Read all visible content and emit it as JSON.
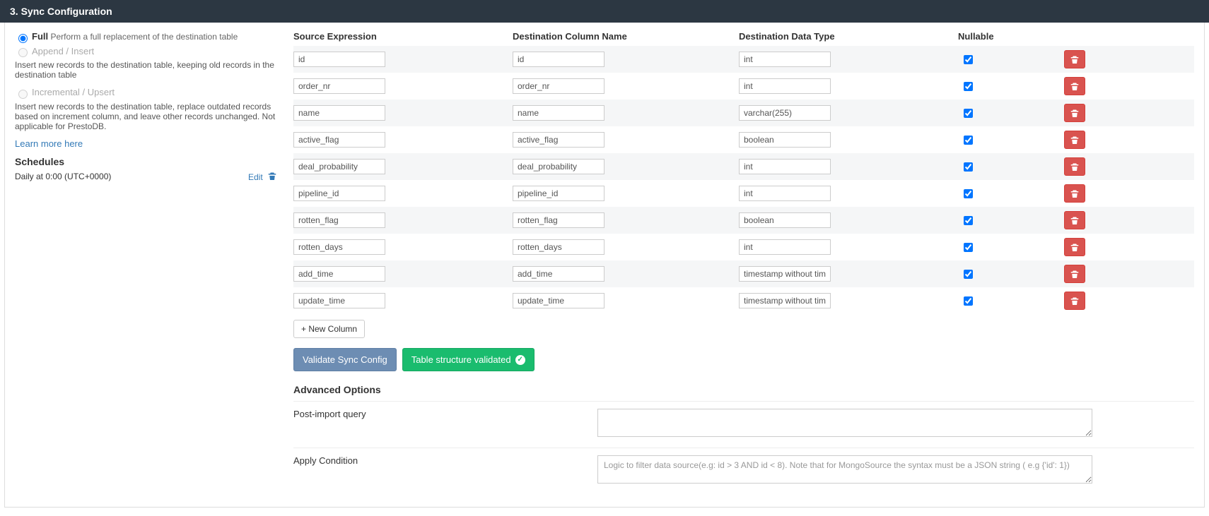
{
  "header": {
    "title": "3. Sync Configuration"
  },
  "sidebar": {
    "modes": [
      {
        "label": "Full",
        "desc": "Perform a full replacement of the destination table",
        "checked": true,
        "disabled": false,
        "inline": true
      },
      {
        "label": "Append / Insert",
        "desc": "Insert new records to the destination table, keeping old records in the destination table",
        "checked": false,
        "disabled": true,
        "inline": false
      },
      {
        "label": "Incremental / Upsert",
        "desc": "Insert new records to the destination table, replace outdated records based on increment column, and leave other records unchanged. Not applicable for PrestoDB.",
        "checked": false,
        "disabled": true,
        "inline": false
      }
    ],
    "learn_more": "Learn more here",
    "schedules_title": "Schedules",
    "schedule_text": "Daily at 0:00 (UTC+0000)",
    "edit_label": "Edit"
  },
  "table": {
    "headers": {
      "source": "Source Expression",
      "dest": "Destination Column Name",
      "type": "Destination Data Type",
      "nullable": "Nullable"
    },
    "rows": [
      {
        "source": "id",
        "dest": "id",
        "type": "int",
        "nullable": true
      },
      {
        "source": "order_nr",
        "dest": "order_nr",
        "type": "int",
        "nullable": true
      },
      {
        "source": "name",
        "dest": "name",
        "type": "varchar(255)",
        "nullable": true
      },
      {
        "source": "active_flag",
        "dest": "active_flag",
        "type": "boolean",
        "nullable": true
      },
      {
        "source": "deal_probability",
        "dest": "deal_probability",
        "type": "int",
        "nullable": true
      },
      {
        "source": "pipeline_id",
        "dest": "pipeline_id",
        "type": "int",
        "nullable": true
      },
      {
        "source": "rotten_flag",
        "dest": "rotten_flag",
        "type": "boolean",
        "nullable": true
      },
      {
        "source": "rotten_days",
        "dest": "rotten_days",
        "type": "int",
        "nullable": true
      },
      {
        "source": "add_time",
        "dest": "add_time",
        "type": "timestamp without time zone",
        "nullable": true
      },
      {
        "source": "update_time",
        "dest": "update_time",
        "type": "timestamp without time zone",
        "nullable": true
      }
    ],
    "new_column_label": "+ New Column"
  },
  "actions": {
    "validate": "Validate Sync Config",
    "validated": "Table structure validated"
  },
  "advanced": {
    "title": "Advanced Options",
    "post_import_label": "Post-import query",
    "apply_condition_label": "Apply Condition",
    "apply_condition_placeholder": "Logic to filter data source(e.g: id > 3 AND id < 8). Note that for MongoSource the syntax must be a JSON string ( e.g {'id': 1})"
  }
}
